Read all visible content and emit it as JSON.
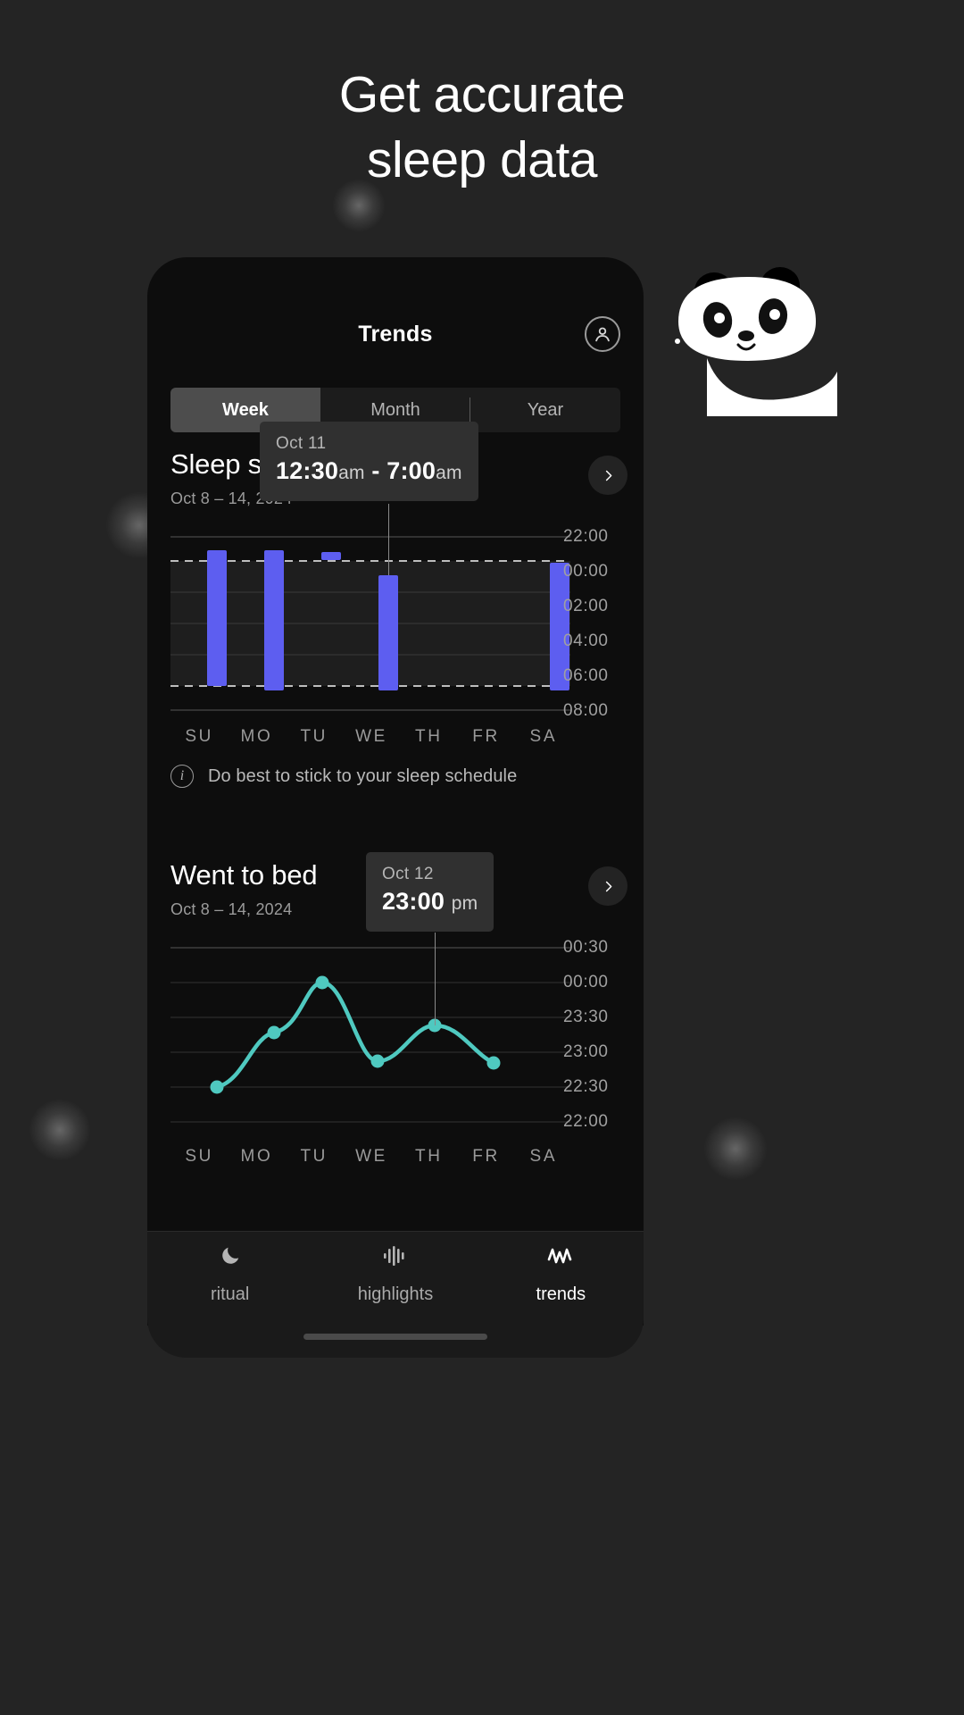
{
  "headline": {
    "line1": "Get accurate",
    "line2": "sleep data"
  },
  "app": {
    "title": "Trends",
    "avatar_icon": "account-circle-icon",
    "tabs": [
      {
        "label": "Week",
        "selected": true
      },
      {
        "label": "Month",
        "selected": false
      },
      {
        "label": "Year",
        "selected": false
      }
    ]
  },
  "sleep_schedule": {
    "title": "Sleep schedule",
    "subtitle": "Oct 8 – 14, 2024",
    "chevron_icon": "chevron-right-icon",
    "tooltip": {
      "date": "Oct 11",
      "start": "12:30",
      "start_unit": "am",
      "dash": "-",
      "end": "7:00",
      "end_unit": "am"
    },
    "info": {
      "icon": "info-icon",
      "text": "Do best to stick to your sleep schedule"
    }
  },
  "went_to_bed": {
    "title": "Went to bed",
    "subtitle": "Oct 8 – 14, 2024",
    "chevron_icon": "chevron-right-icon",
    "tooltip": {
      "date": "Oct 12",
      "value": "23:00",
      "unit": "pm"
    }
  },
  "bottom_nav": [
    {
      "label": "ritual",
      "icon": "moon-icon",
      "active": false
    },
    {
      "label": "highlights",
      "icon": "waveform-icon",
      "active": false
    },
    {
      "label": "trends",
      "icon": "activity-icon",
      "active": true
    }
  ],
  "colors": {
    "page_bg": "#242424",
    "phone_bg": "#0d0d0d",
    "bar": "#5d5ef0",
    "line": "#4fc9c0",
    "tooltip_bg": "#303030",
    "accent_text": "#ffffff"
  },
  "chart_data": [
    {
      "type": "bar",
      "name": "Sleep schedule",
      "title": "Sleep schedule",
      "subtitle": "Oct 8 – 14, 2024",
      "xlabel": "",
      "ylabel": "",
      "categories": [
        "SU",
        "MO",
        "TU",
        "WE",
        "TH",
        "FR",
        "SA"
      ],
      "ytick_labels": [
        "22:00",
        "00:00",
        "02:00",
        "04:00",
        "06:00",
        "08:00"
      ],
      "ylim": [
        "22:00",
        "08:00"
      ],
      "grid": true,
      "legend": "none",
      "series": [
        {
          "name": "sleep period",
          "unit": "hh:mm",
          "bars": [
            {
              "category": "SU",
              "start": "23:40",
              "end": "06:50"
            },
            {
              "category": "MO",
              "start": "23:35",
              "end": "07:20"
            },
            {
              "category": "TU",
              "start": "23:25",
              "end": "23:35"
            },
            {
              "category": "WE",
              "start": "00:30",
              "end": "07:00"
            },
            {
              "category": "TH",
              "start": null,
              "end": null
            },
            {
              "category": "FR",
              "start": null,
              "end": null
            },
            {
              "category": "SA",
              "start": "00:00",
              "end": "07:10"
            }
          ]
        }
      ],
      "reference_lines": [
        {
          "label": "00:00",
          "style": "dashed"
        },
        {
          "label": "06:30",
          "style": "dashed"
        }
      ],
      "highlight": {
        "category": "WE",
        "date": "Oct 11",
        "start": "12:30 am",
        "end": "7:00 am"
      }
    },
    {
      "type": "line",
      "name": "Went to bed",
      "title": "Went to bed",
      "subtitle": "Oct 8 – 14, 2024",
      "xlabel": "",
      "ylabel": "",
      "categories": [
        "SU",
        "MO",
        "TU",
        "WE",
        "TH",
        "FR",
        "SA"
      ],
      "ytick_labels": [
        "00:30",
        "00:00",
        "23:30",
        "23:00",
        "22:30",
        "22:00"
      ],
      "ylim": [
        "22:00",
        "00:30"
      ],
      "grid": true,
      "legend": "none",
      "series": [
        {
          "name": "bedtime",
          "unit": "hh:mm",
          "values": [
            "22:20",
            "23:25",
            "23:55",
            "23:05",
            "23:30",
            "23:15",
            null
          ]
        }
      ],
      "highlight": {
        "category": "TH",
        "date": "Oct 12",
        "value": "23:00 pm"
      }
    }
  ]
}
